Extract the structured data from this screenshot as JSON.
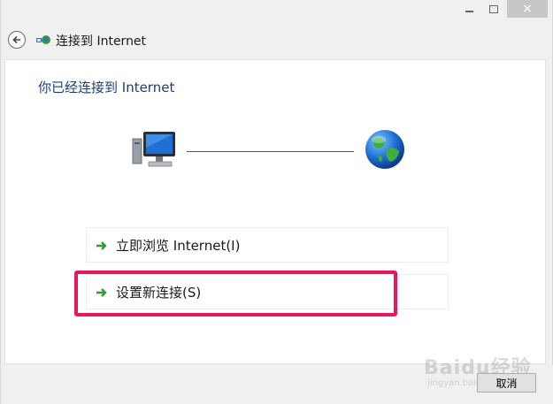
{
  "window": {
    "controls": {
      "minimize": "minimize-icon",
      "maximize": "maximize-icon",
      "close": "×"
    }
  },
  "header": {
    "title": "连接到 Internet",
    "back_icon": "back-arrow-icon",
    "title_icon": "network-globe-icon"
  },
  "main": {
    "heading": "你已经连接到 Internet",
    "options": [
      {
        "label": "立即浏览 Internet(I)",
        "icon": "green-arrow-icon"
      },
      {
        "label": "设置新连接(S)",
        "icon": "green-arrow-icon"
      }
    ]
  },
  "footer": {
    "cancel_label": "取消"
  },
  "watermark": {
    "text": "Baidu经验",
    "sub": "jingyan.baidu.com"
  },
  "colors": {
    "heading": "#1f3d7a",
    "highlight": "#e8175d",
    "arrow": "#2e9e2e"
  }
}
